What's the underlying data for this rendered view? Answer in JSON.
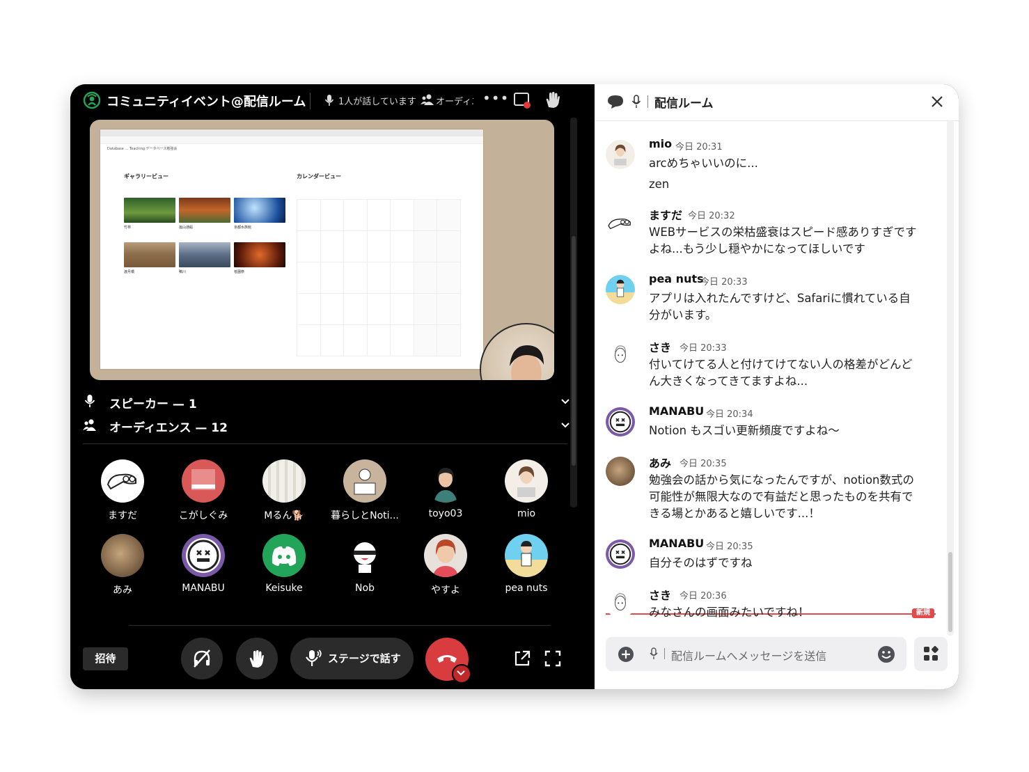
{
  "stage": {
    "title": "コミュニティイベント@配信ルーム",
    "speaking": "1人が話しています",
    "audience_trunc": "オーディエ",
    "share": {
      "crumbs": "Database  …  Teaching  データベース勉強会",
      "gallery_heading": "ギャラリービュー",
      "calendar_heading": "カレンダービュー",
      "gallery": [
        "竹林",
        "嵐山通船",
        "京都水族館",
        "渡月橋",
        "鴨川",
        "祇園祭"
      ]
    },
    "speakers_label": "スピーカー — 1",
    "audience_label": "オーディエンス — 12",
    "audience": [
      {
        "name": "ますだ"
      },
      {
        "name": "こがしぐみ"
      },
      {
        "name": "Mるん🐕"
      },
      {
        "name": "暮らしとNoti..."
      },
      {
        "name": "toyo03"
      },
      {
        "name": "mio"
      },
      {
        "name": "あみ"
      },
      {
        "name": "MANABU"
      },
      {
        "name": "Keisuke"
      },
      {
        "name": "Nob"
      },
      {
        "name": "やすよ"
      },
      {
        "name": "pea nuts"
      }
    ],
    "invite_label": "招待",
    "talk_label": "ステージで話す",
    "colors": {
      "leave": "#d83c3e",
      "accent_green": "#23a55a",
      "discord": "#23a559"
    }
  },
  "chat": {
    "title": "配信ルーム",
    "messages": [
      {
        "author": "mio",
        "time": "今日 20:31",
        "text": "arcめちゃいいのに...",
        "text2": "zen"
      },
      {
        "author": "ますだ",
        "time": "今日 20:32",
        "text": "WEBサービスの栄枯盛衰はスピード感ありすぎですよね...もう少し穏やかになってほしいです"
      },
      {
        "author": "pea nuts",
        "time": "今日 20:33",
        "text": "アプリは入れたんですけど、Safariに慣れている自分がいます。"
      },
      {
        "author": "さき",
        "time": "今日 20:33",
        "text": "付いてけてる人と付けてけてない人の格差がどんどん大きくなってきてますよね..."
      },
      {
        "author": "MANABU",
        "time": "今日 20:34",
        "text": "Notion もスゴい更新頻度ですよね〜"
      },
      {
        "author": "あみ",
        "time": "今日 20:35",
        "text": "勉強会の話から気になったんですが、notion数式の可能性が無限大なので有益だと思ったものを共有できる場とかあると嬉しいです...！"
      },
      {
        "author": "MANABU",
        "time": "今日 20:35",
        "text": "自分そのはずですね"
      },
      {
        "author": "さき",
        "time": "今日 20:36",
        "text": "みなさんの画面みたいですね！"
      }
    ],
    "new_badge": "新規",
    "composer_placeholder": "配信ルームへメッセージを送信",
    "colors": {
      "new_line": "#e04c4c"
    }
  }
}
